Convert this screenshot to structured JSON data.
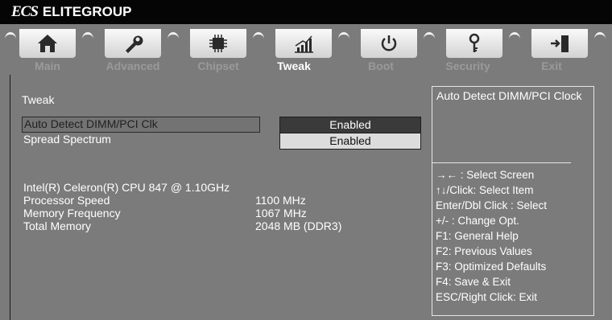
{
  "header": {
    "brand_mark": "ECS",
    "brand_name": "ELITEGROUP"
  },
  "tabs": [
    {
      "label": "Main",
      "icon": "home-icon"
    },
    {
      "label": "Advanced",
      "icon": "wrench-icon"
    },
    {
      "label": "Chipset",
      "icon": "chip-icon"
    },
    {
      "label": "Tweak",
      "icon": "performance-chart-icon",
      "active": true
    },
    {
      "label": "Boot",
      "icon": "power-icon"
    },
    {
      "label": "Security",
      "icon": "key-icon"
    },
    {
      "label": "Exit",
      "icon": "exit-door-icon"
    }
  ],
  "main": {
    "title": "Tweak",
    "settings": [
      {
        "label": "Auto Detect DIMM/PCI Clk",
        "value": "Enabled",
        "selected": true
      },
      {
        "label": "Spread Spectrum",
        "value": "Enabled",
        "selected": false
      }
    ],
    "cpu_name": "Intel(R)  Celeron(R) CPU 847 @ 1.10GHz",
    "info": [
      {
        "label": "Processor Speed",
        "value": "1100 MHz"
      },
      {
        "label": "Memory Frequency",
        "value": "1067 MHz"
      },
      {
        "label": "Total Memory",
        "value": "2048 MB (DDR3)"
      }
    ]
  },
  "help": {
    "description": "Auto Detect DIMM/PCI Clock",
    "keys": [
      "→←  : Select Screen",
      "↑↓/Click: Select Item",
      "Enter/Dbl Click : Select",
      "+/- : Change Opt.",
      "F1: General Help",
      "F2: Previous Values",
      "F3: Optimized Defaults",
      "F4: Save & Exit",
      "ESC/Right Click: Exit"
    ]
  },
  "colors": {
    "background": "#7b7b7b",
    "header": "#050505",
    "selected_value": "#3a3a3a",
    "unselected_value": "#dcdcdc",
    "active_tab_text": "#ffffff",
    "inactive_tab_text": "#9a9a9a"
  }
}
